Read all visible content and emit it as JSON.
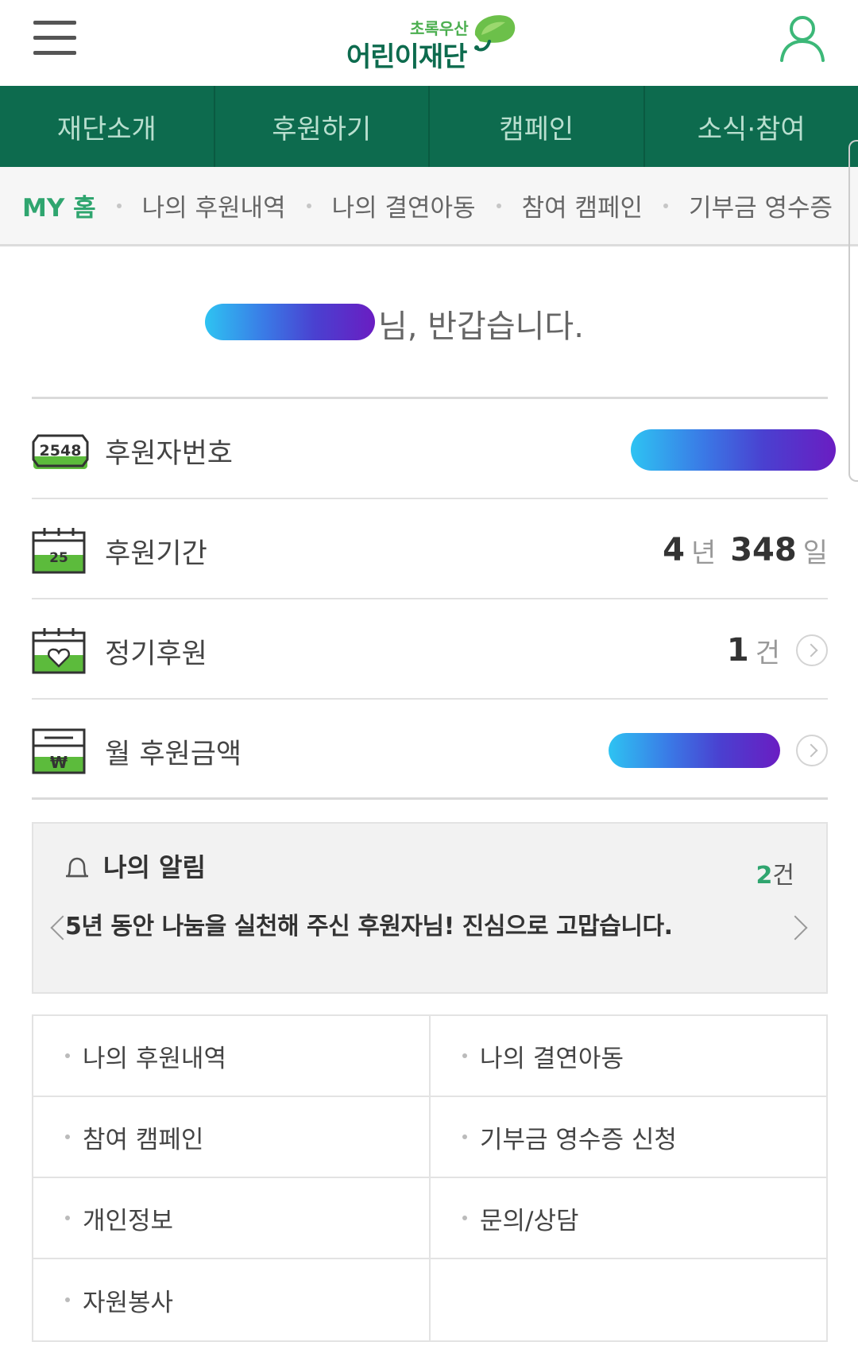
{
  "header": {
    "logo_sub": "초록우산",
    "logo_main": "어린이재단"
  },
  "main_nav": {
    "tabs": [
      "재단소개",
      "후원하기",
      "캠페인",
      "소식·참여"
    ]
  },
  "sub_nav": {
    "items": [
      "MY 홈",
      "나의 후원내역",
      "나의 결연아동",
      "참여 캠페인",
      "기부금 영수증"
    ],
    "active_index": 0
  },
  "greeting": {
    "suffix": "님, 반갑습니다."
  },
  "info": {
    "donor_number_label": "후원자번호",
    "donor_number_icon_text": "2548",
    "period_label": "후원기간",
    "period_icon_text": "25",
    "period_years": "4",
    "period_years_unit": "년",
    "period_days": "348",
    "period_days_unit": "일",
    "regular_label": "정기후원",
    "regular_count": "1",
    "regular_unit": "건",
    "monthly_label": "월 후원금액",
    "monthly_icon_text": "₩"
  },
  "notice": {
    "title": "나의 알림",
    "count_num": "2",
    "count_unit": "건",
    "message": "5년 동안 나눔을 실천해 주신 후원자님! 진심으로 고맙습니다."
  },
  "quick_menu": {
    "items": [
      "나의 후원내역",
      "나의 결연아동",
      "참여 캠페인",
      "기부금 영수증 신청",
      "개인정보",
      "문의/상담",
      "자원봉사"
    ]
  },
  "colors": {
    "brand_green": "#0d6b4e",
    "accent_green": "#2fa56f",
    "mask_gradient_start": "#2ec3f2",
    "mask_gradient_end": "#6a1dc2"
  }
}
